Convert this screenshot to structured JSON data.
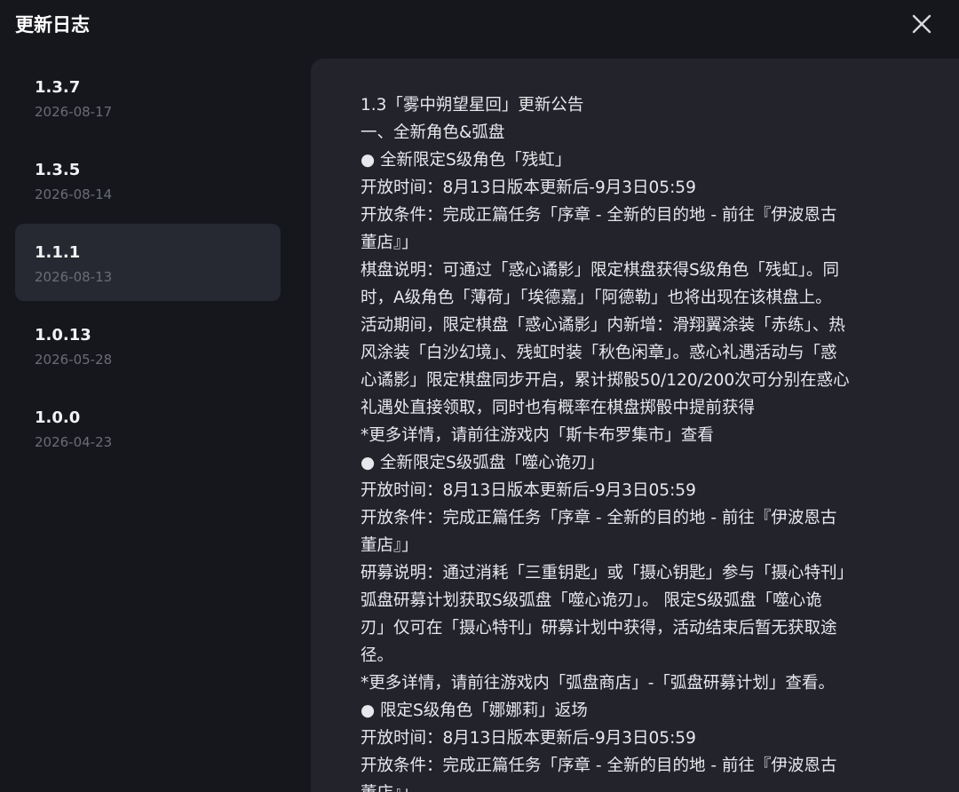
{
  "header": {
    "title": "更新日志"
  },
  "sidebar": {
    "items": [
      {
        "version": "1.3.7",
        "date": "2026-08-17",
        "active": false
      },
      {
        "version": "1.3.5",
        "date": "2026-08-14",
        "active": false
      },
      {
        "version": "1.1.1",
        "date": "2026-08-13",
        "active": true
      },
      {
        "version": "1.0.13",
        "date": "2026-05-28",
        "active": false
      },
      {
        "version": "1.0.0",
        "date": "2026-04-23",
        "active": false
      }
    ]
  },
  "content": {
    "lines": [
      "1.3「雾中朔望星回」更新公告",
      "一、全新角色&弧盘",
      "● 全新限定S级角色「残虹」",
      "开放时间：8月13日版本更新后-9月3日05:59",
      "开放条件：完成正篇任务「序章 - 全新的目的地 - 前往『伊波恩古",
      "董店』」",
      "棋盘说明：可通过「惑心谲影」限定棋盘获得S级角色「残虹」。同",
      "时，A级角色「薄荷」「埃德嘉」「阿德勒」也将出现在该棋盘上。",
      "活动期间，限定棋盘「惑心谲影」内新增：滑翔翼涂装「赤练」、热",
      "风涂装「白沙幻境」、残虹时装「秋色闲章」。惑心礼遇活动与「惑",
      "心谲影」限定棋盘同步开启，累计掷骰50/120/200次可分别在惑心",
      "礼遇处直接领取，同时也有概率在棋盘掷骰中提前获得",
      "*更多详情，请前往游戏内「斯卡布罗集市」查看",
      "● 全新限定S级弧盘「噬心诡刃」",
      "开放时间：8月13日版本更新后-9月3日05:59",
      "开放条件：完成正篇任务「序章 - 全新的目的地 - 前往『伊波恩古",
      "董店』」",
      "研募说明：通过消耗「三重钥匙」或「摄心钥匙」参与「摄心特刊」",
      "弧盘研募计划获取S级弧盘「噬心诡刃」。 限定S级弧盘「噬心诡",
      "刃」仅可在「摄心特刊」研募计划中获得，活动结束后暂无获取途",
      "径。",
      "*更多详情，请前往游戏内「弧盘商店」-「弧盘研募计划」查看。",
      "● 限定S级角色「娜娜莉」返场",
      "开放时间：8月13日版本更新后-9月3日05:59",
      "开放条件：完成正篇任务「序章 - 全新的目的地 - 前往『伊波恩古",
      "董店』」"
    ]
  },
  "colors": {
    "background": "#16171d",
    "panel": "#22232b",
    "active_item": "#262832",
    "text_primary": "#e8e8ec",
    "text_secondary": "#6a6c76"
  },
  "icons": {
    "close": "close-icon"
  }
}
